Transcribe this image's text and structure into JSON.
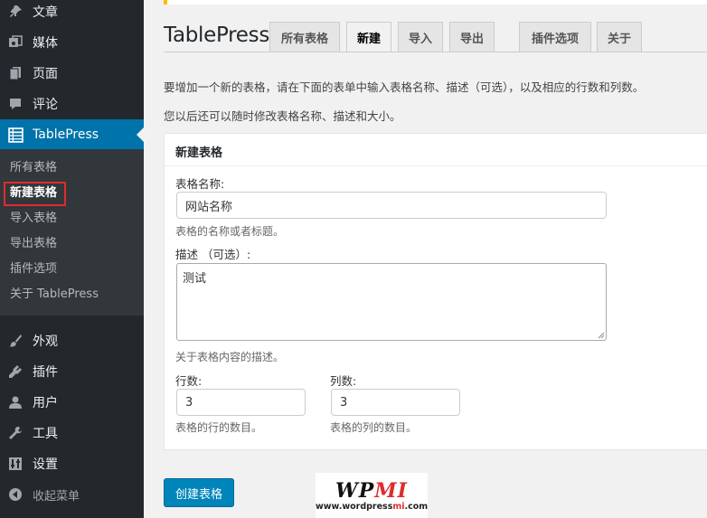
{
  "sidebar": {
    "items": [
      {
        "label": "文章",
        "icon": "pushpin-icon"
      },
      {
        "label": "媒体",
        "icon": "media-icon"
      },
      {
        "label": "页面",
        "icon": "page-icon"
      },
      {
        "label": "评论",
        "icon": "comment-icon"
      },
      {
        "label": "TablePress",
        "icon": "table-icon"
      },
      {
        "label": "外观",
        "icon": "paintbrush-icon"
      },
      {
        "label": "插件",
        "icon": "plugin-icon"
      },
      {
        "label": "用户",
        "icon": "user-icon"
      },
      {
        "label": "工具",
        "icon": "wrench-icon"
      },
      {
        "label": "设置",
        "icon": "settings-icon"
      },
      {
        "label": "收起菜单",
        "icon": "collapse-icon"
      }
    ],
    "submenu": [
      "所有表格",
      "新建表格",
      "导入表格",
      "导出表格",
      "插件选项",
      "关于 TablePress"
    ]
  },
  "header": {
    "title": "TablePress",
    "tabs": [
      "所有表格",
      "新建",
      "导入",
      "导出",
      "插件选项",
      "关于"
    ]
  },
  "intro": {
    "line1": "要增加一个新的表格，请在下面的表单中输入表格名称、描述（可选），以及相应的行数和列数。",
    "line2": "您以后还可以随时修改表格名称、描述和大小。"
  },
  "form": {
    "panel_title": "新建表格",
    "name_label": "表格名称:",
    "name_value": "网站名称",
    "name_hint": "表格的名称或者标题。",
    "desc_label": "描述 （可选）:",
    "desc_value": "测试",
    "desc_hint": "关于表格内容的描述。",
    "rows_label": "行数:",
    "rows_value": "3",
    "rows_hint": "表格的行的数目。",
    "cols_label": "列数:",
    "cols_value": "3",
    "cols_hint": "表格的列的数目。",
    "submit_label": "创建表格"
  },
  "watermark": {
    "word_a": "WP",
    "word_b": "MI",
    "url_a": "www.wordpress",
    "url_b": "mi",
    "url_c": ".com"
  },
  "colors": {
    "accent": "#0073aa",
    "highlight": "#e02b2b",
    "sidebar": "#23282d"
  }
}
